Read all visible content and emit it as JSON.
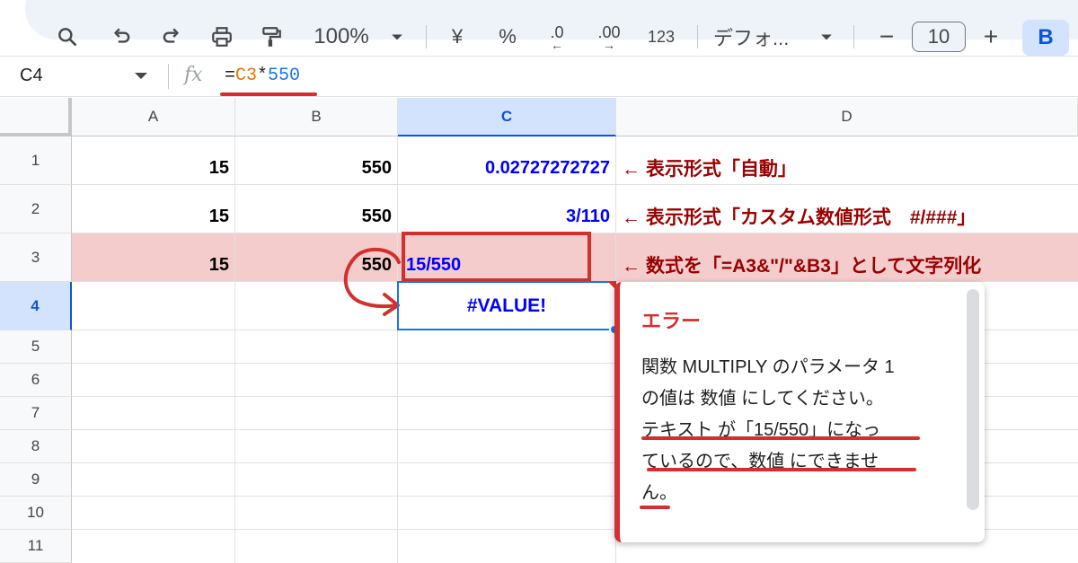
{
  "toolbar": {
    "zoom": "100%",
    "currency": "¥",
    "percent": "%",
    "decrease_decimal": ".0",
    "increase_decimal": ".00",
    "more_formats": "123",
    "font": "デフォ...",
    "font_size": "10",
    "minus": "−",
    "plus": "+",
    "bold": "B"
  },
  "formula_bar": {
    "cell_ref": "C4",
    "fx": "fx",
    "formula_prefix": "=",
    "formula_ref": "C3",
    "formula_op": "*",
    "formula_num": "550"
  },
  "columns": [
    "A",
    "B",
    "C",
    "D"
  ],
  "selected_column": "C",
  "rows": [
    "1",
    "2",
    "3",
    "4",
    "5",
    "6",
    "7",
    "8",
    "9",
    "10",
    "11"
  ],
  "selected_row": "4",
  "cells": {
    "A1": "15",
    "B1": "550",
    "C1": "0.02727272727",
    "A2": "15",
    "B2": "550",
    "C2": "3/110",
    "A3": "15",
    "B3": "550",
    "C3": "15/550",
    "C4": "#VALUE!"
  },
  "notes": {
    "d1": "← 表示形式「自動」",
    "d2": "← 表示形式「カスタム数値形式　#/###」",
    "d3": "← 数式を「=A3&\"/\"&B3」として文字列化"
  },
  "tooltip": {
    "title": "エラー",
    "lines": [
      "関数 MULTIPLY のパラメータ 1",
      "の値は 数値 にしてください。",
      "テキスト が「15/550」になっ",
      "ているので、数値 にできませ",
      "ん。"
    ]
  },
  "colors": {
    "highlight_row": "#f4cccc",
    "annotation_red": "#d32f2f",
    "note_text": "#990000",
    "value_blue": "#0000ff",
    "selection_blue": "#1a73e8"
  }
}
